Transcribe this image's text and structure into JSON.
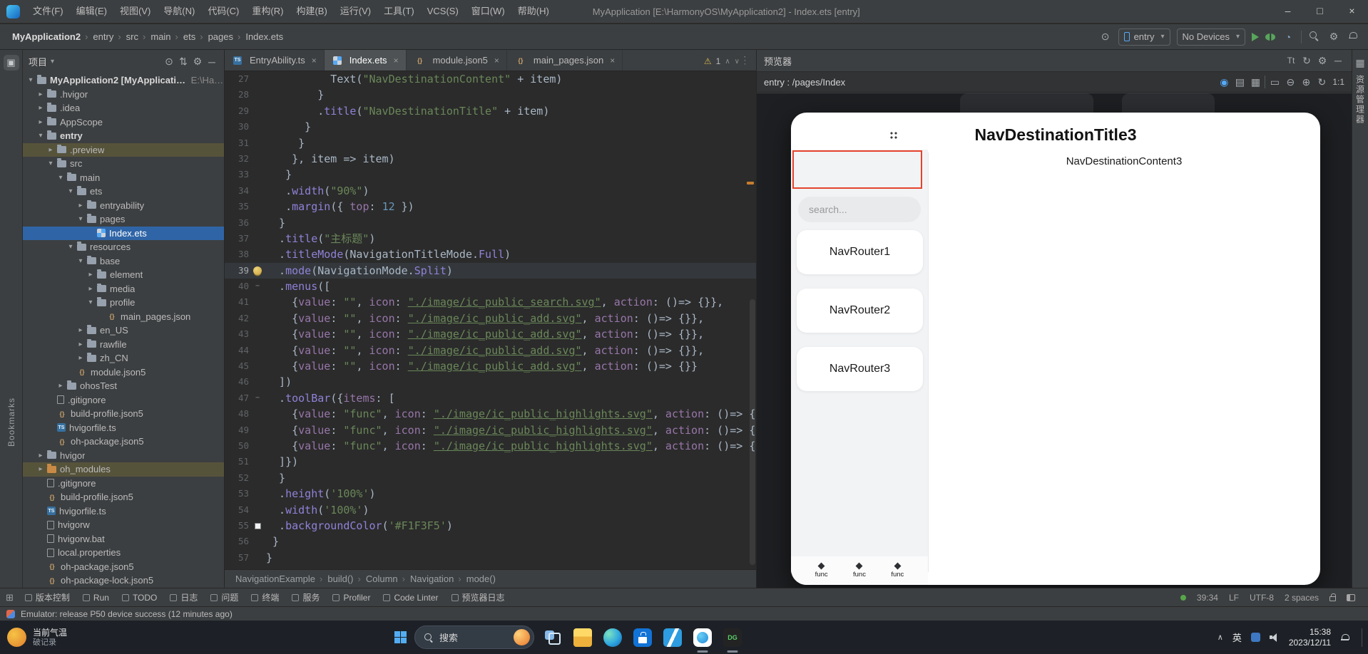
{
  "titlebar": {
    "menus": [
      "文件(F)",
      "编辑(E)",
      "视图(V)",
      "导航(N)",
      "代码(C)",
      "重构(R)",
      "构建(B)",
      "运行(V)",
      "工具(T)",
      "VCS(S)",
      "窗口(W)",
      "帮助(H)"
    ],
    "title": "MyApplication [E:\\HarmonyOS\\MyApplication2] - Index.ets [entry]",
    "window_buttons": [
      "–",
      "□",
      "×"
    ]
  },
  "toolbar": {
    "breadcrumbs": [
      "MyApplication2",
      "entry",
      "src",
      "main",
      "ets",
      "pages",
      "Index.ets"
    ],
    "run_config_label": "entry",
    "device_label": "No Devices",
    "right_icons": [
      "run-icon",
      "debug-icon",
      "profiler-icon",
      "divider",
      "search-icon",
      "settings-icon",
      "bell-icon"
    ]
  },
  "left_strip": {
    "bookmarks_label": "Bookmarks"
  },
  "project": {
    "panel_title": "项目",
    "header_icons": [
      "locate-icon",
      "collapse-icon",
      "settings-icon",
      "hide-icon"
    ],
    "tree": [
      {
        "label": "MyApplication2 [MyApplication]",
        "path": "E:\\Harm",
        "level": 0,
        "chevron": "open",
        "icon": "folder",
        "bold": true
      },
      {
        "label": ".hvigor",
        "level": 1,
        "chevron": "closed",
        "icon": "folder"
      },
      {
        "label": ".idea",
        "level": 1,
        "chevron": "closed",
        "icon": "folder"
      },
      {
        "label": "AppScope",
        "level": 1,
        "chevron": "closed",
        "icon": "folder"
      },
      {
        "label": "entry",
        "level": 1,
        "chevron": "open",
        "icon": "folder",
        "bold": true
      },
      {
        "label": ".preview",
        "level": 2,
        "chevron": "closed",
        "icon": "folder",
        "state": "excluded"
      },
      {
        "label": "src",
        "level": 2,
        "chevron": "open",
        "icon": "folder"
      },
      {
        "label": "main",
        "level": 3,
        "chevron": "open",
        "icon": "folder"
      },
      {
        "label": "ets",
        "level": 4,
        "chevron": "open",
        "icon": "folder"
      },
      {
        "label": "entryability",
        "level": 5,
        "chevron": "closed",
        "icon": "folder"
      },
      {
        "label": "pages",
        "level": 5,
        "chevron": "open",
        "icon": "folder"
      },
      {
        "label": "Index.ets",
        "level": 6,
        "chevron": "none",
        "icon": "ets",
        "state": "selected"
      },
      {
        "label": "resources",
        "level": 4,
        "chevron": "open",
        "icon": "folder"
      },
      {
        "label": "base",
        "level": 5,
        "chevron": "open",
        "icon": "folder"
      },
      {
        "label": "element",
        "level": 6,
        "chevron": "closed",
        "icon": "folder"
      },
      {
        "label": "media",
        "level": 6,
        "chevron": "closed",
        "icon": "folder"
      },
      {
        "label": "profile",
        "level": 6,
        "chevron": "open",
        "icon": "folder"
      },
      {
        "label": "main_pages.json",
        "level": 7,
        "chevron": "none",
        "icon": "json"
      },
      {
        "label": "en_US",
        "level": 5,
        "chevron": "closed",
        "icon": "folder"
      },
      {
        "label": "rawfile",
        "level": 5,
        "chevron": "closed",
        "icon": "folder"
      },
      {
        "label": "zh_CN",
        "level": 5,
        "chevron": "closed",
        "icon": "folder"
      },
      {
        "label": "module.json5",
        "level": 4,
        "chevron": "none",
        "icon": "json"
      },
      {
        "label": "ohosTest",
        "level": 3,
        "chevron": "closed",
        "icon": "folder"
      },
      {
        "label": ".gitignore",
        "level": 2,
        "chevron": "none",
        "icon": "file"
      },
      {
        "label": "build-profile.json5",
        "level": 2,
        "chevron": "none",
        "icon": "json"
      },
      {
        "label": "hvigorfile.ts",
        "level": 2,
        "chevron": "none",
        "icon": "ts"
      },
      {
        "label": "oh-package.json5",
        "level": 2,
        "chevron": "none",
        "icon": "json"
      },
      {
        "label": "hvigor",
        "level": 1,
        "chevron": "closed",
        "icon": "folder"
      },
      {
        "label": "oh_modules",
        "level": 1,
        "chevron": "closed",
        "icon": "folder-orange",
        "state": "excluded"
      },
      {
        "label": ".gitignore",
        "level": 1,
        "chevron": "none",
        "icon": "file"
      },
      {
        "label": "build-profile.json5",
        "level": 1,
        "chevron": "none",
        "icon": "json"
      },
      {
        "label": "hvigorfile.ts",
        "level": 1,
        "chevron": "none",
        "icon": "ts"
      },
      {
        "label": "hvigorw",
        "level": 1,
        "chevron": "none",
        "icon": "file"
      },
      {
        "label": "hvigorw.bat",
        "level": 1,
        "chevron": "none",
        "icon": "file"
      },
      {
        "label": "local.properties",
        "level": 1,
        "chevron": "none",
        "icon": "file"
      },
      {
        "label": "oh-package.json5",
        "level": 1,
        "chevron": "none",
        "icon": "json"
      },
      {
        "label": "oh-package-lock.json5",
        "level": 1,
        "chevron": "none",
        "icon": "json"
      }
    ]
  },
  "editor": {
    "tabs": [
      {
        "label": "EntryAbility.ts",
        "icon": "ts",
        "active": false
      },
      {
        "label": "Index.ets",
        "icon": "ets",
        "active": true
      },
      {
        "label": "module.json5",
        "icon": "json",
        "active": false
      },
      {
        "label": "main_pages.json",
        "icon": "json",
        "active": false
      }
    ],
    "warning_count": "1",
    "code_start": 27,
    "caret_line": 39,
    "bulb_line": 39,
    "swatch_line": 55,
    "swatch_color": "#F1F3F5",
    "fold_lines": [
      40,
      47
    ],
    "code_lines": [
      "          Text(\"NavDestinationContent\" + item)",
      "        }",
      "        .title(\"NavDestinationTitle\" + item)",
      "      }",
      "     }",
      "    }, item => item)",
      "   }",
      "   .width(\"90%\")",
      "   .margin({ top: 12 })",
      "  }",
      "  .title(\"主标题\")",
      "  .titleMode(NavigationTitleMode.Full)",
      "  .mode(NavigationMode.Split)",
      "  .menus([",
      "    {value: \"\", icon: \"./image/ic_public_search.svg\", action: ()=> {}},",
      "    {value: \"\", icon: \"./image/ic_public_add.svg\", action: ()=> {}},",
      "    {value: \"\", icon: \"./image/ic_public_add.svg\", action: ()=> {}},",
      "    {value: \"\", icon: \"./image/ic_public_add.svg\", action: ()=> {}},",
      "    {value: \"\", icon: \"./image/ic_public_add.svg\", action: ()=> {}}",
      "  ])",
      "  .toolBar({items: [",
      "    {value: \"func\", icon: \"./image/ic_public_highlights.svg\", action: ()=> {}},",
      "    {value: \"func\", icon: \"./image/ic_public_highlights.svg\", action: ()=> {}},",
      "    {value: \"func\", icon: \"./image/ic_public_highlights.svg\", action: ()=> {}}",
      "  ]})",
      "  }",
      "  .height('100%')",
      "  .width('100%')",
      "  .backgroundColor('#F1F3F5')",
      " }",
      "}"
    ],
    "breadcrumbs": [
      "NavigationExample",
      "build()",
      "Column",
      "Navigation",
      "mode()"
    ]
  },
  "preview": {
    "panel_title": "预览器",
    "header_icons": [
      "font-scale-icon",
      "refresh-icon",
      "settings-icon",
      "hide-icon"
    ],
    "page_label": "entry : /pages/Index",
    "sub_icons": [
      "target-icon",
      "layers-icon",
      "grid-icon",
      "divider",
      "frame-icon",
      "zoom-out-icon",
      "zoom-in-icon",
      "rotate-icon"
    ],
    "zoom_label": "1:1",
    "phone": {
      "title": "NavDestinationTitle3",
      "content_text": "NavDestinationContent3",
      "search_placeholder": "search...",
      "nav_routers": [
        "NavRouter1",
        "NavRouter2",
        "NavRouter3"
      ],
      "toolbar_items": [
        "func",
        "func",
        "func"
      ]
    }
  },
  "right_strip": {
    "label": "资源管理器"
  },
  "bottom_bar": {
    "items": [
      "版本控制",
      "Run",
      "TODO",
      "日志",
      "问题",
      "终端",
      "服务",
      "Profiler",
      "Code Linter",
      "预览器日志"
    ],
    "caret_position": "39:34",
    "line_separator": "LF",
    "encoding": "UTF-8",
    "indent_info": "2 spaces"
  },
  "status_bar": {
    "message": "Emulator: release P50 device success (12 minutes ago)"
  },
  "taskbar": {
    "weather_title": "当前气温",
    "weather_sub": "破记录",
    "search_label": "搜索",
    "apps": [
      "taskview",
      "explorer",
      "edge",
      "store",
      "vscode",
      "deveco",
      "datagrip"
    ],
    "datagrip_label": "DG",
    "ime_label": "英",
    "time": "15:38",
    "date": "2023/12/11"
  }
}
